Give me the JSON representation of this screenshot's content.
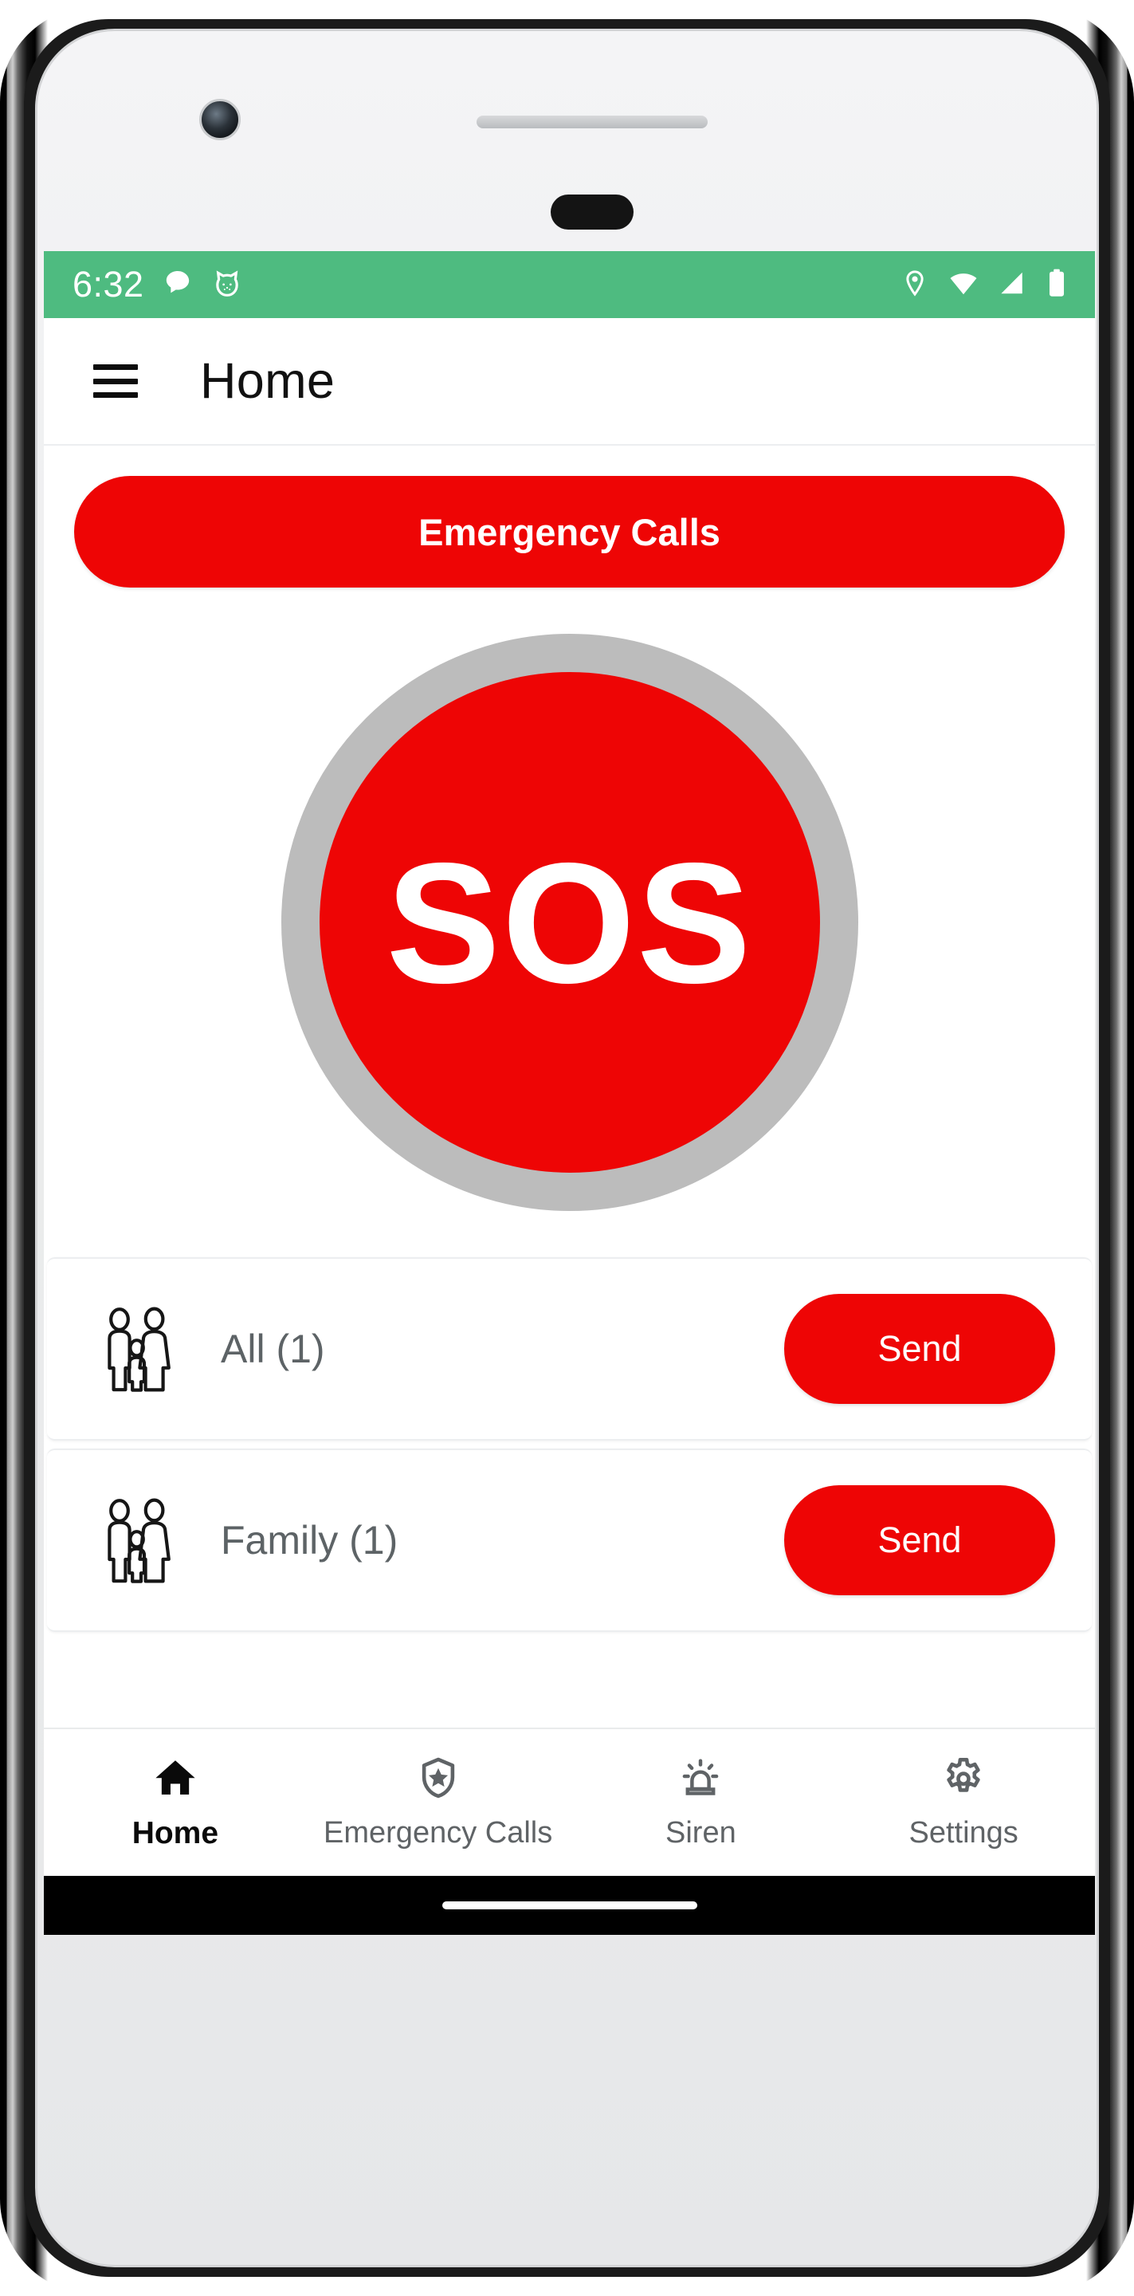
{
  "theme": {
    "status_bar_green": "#4EBB80",
    "accent_red": "#EE0505",
    "sos_ring_gray": "#BCBCBC",
    "muted_text": "#5D6366",
    "active_text": "#0A0A0A"
  },
  "status_bar": {
    "time": "6:32",
    "left_icons": [
      "message-bubble-icon",
      "cat-face-icon"
    ],
    "right_icons": [
      "location-pin-icon",
      "wifi-icon",
      "cellular-signal-icon",
      "battery-icon"
    ]
  },
  "app_bar": {
    "menu_icon": "hamburger-menu-icon",
    "title": "Home"
  },
  "main": {
    "emergency_calls_button": "Emergency Calls",
    "sos_button": "SOS",
    "groups": [
      {
        "icon": "family-group-icon",
        "name": "All (1)",
        "action": "Send"
      },
      {
        "icon": "family-group-icon",
        "name": "Family (1)",
        "action": "Send"
      }
    ]
  },
  "bottom_nav": {
    "items": [
      {
        "label": "Home",
        "icon": "home-icon",
        "active": true
      },
      {
        "label": "Emergency Calls",
        "icon": "shield-star-icon",
        "active": false
      },
      {
        "label": "Siren",
        "icon": "siren-beacon-icon",
        "active": false
      },
      {
        "label": "Settings",
        "icon": "gear-icon",
        "active": false
      }
    ]
  }
}
